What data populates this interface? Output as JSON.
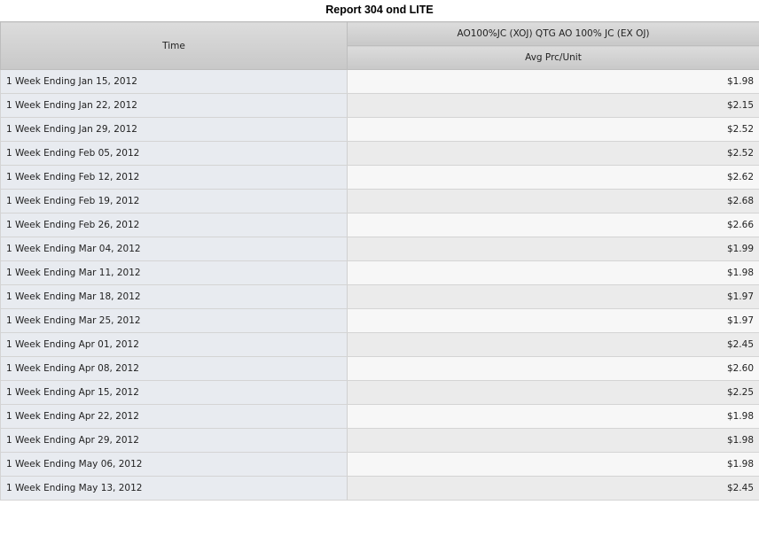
{
  "report": {
    "title": "Report 304 ond LITE",
    "time_header": "Time",
    "product_header": "AO100%JC (XOJ) QTG AO 100% JC (EX OJ)",
    "metric_header": "Avg Prc/Unit",
    "rows": [
      {
        "time": "1 Week Ending Jan 15, 2012",
        "value": "$1.98"
      },
      {
        "time": "1 Week Ending Jan 22, 2012",
        "value": "$2.15"
      },
      {
        "time": "1 Week Ending Jan 29, 2012",
        "value": "$2.52"
      },
      {
        "time": "1 Week Ending Feb 05, 2012",
        "value": "$2.52"
      },
      {
        "time": "1 Week Ending Feb 12, 2012",
        "value": "$2.62"
      },
      {
        "time": "1 Week Ending Feb 19, 2012",
        "value": "$2.68"
      },
      {
        "time": "1 Week Ending Feb 26, 2012",
        "value": "$2.66"
      },
      {
        "time": "1 Week Ending Mar 04, 2012",
        "value": "$1.99"
      },
      {
        "time": "1 Week Ending Mar 11, 2012",
        "value": "$1.98"
      },
      {
        "time": "1 Week Ending Mar 18, 2012",
        "value": "$1.97"
      },
      {
        "time": "1 Week Ending Mar 25, 2012",
        "value": "$1.97"
      },
      {
        "time": "1 Week Ending Apr 01, 2012",
        "value": "$2.45"
      },
      {
        "time": "1 Week Ending Apr 08, 2012",
        "value": "$2.60"
      },
      {
        "time": "1 Week Ending Apr 15, 2012",
        "value": "$2.25"
      },
      {
        "time": "1 Week Ending Apr 22, 2012",
        "value": "$1.98"
      },
      {
        "time": "1 Week Ending Apr 29, 2012",
        "value": "$1.98"
      },
      {
        "time": "1 Week Ending May 06, 2012",
        "value": "$1.98"
      },
      {
        "time": "1 Week Ending May 13, 2012",
        "value": "$2.45"
      }
    ]
  }
}
